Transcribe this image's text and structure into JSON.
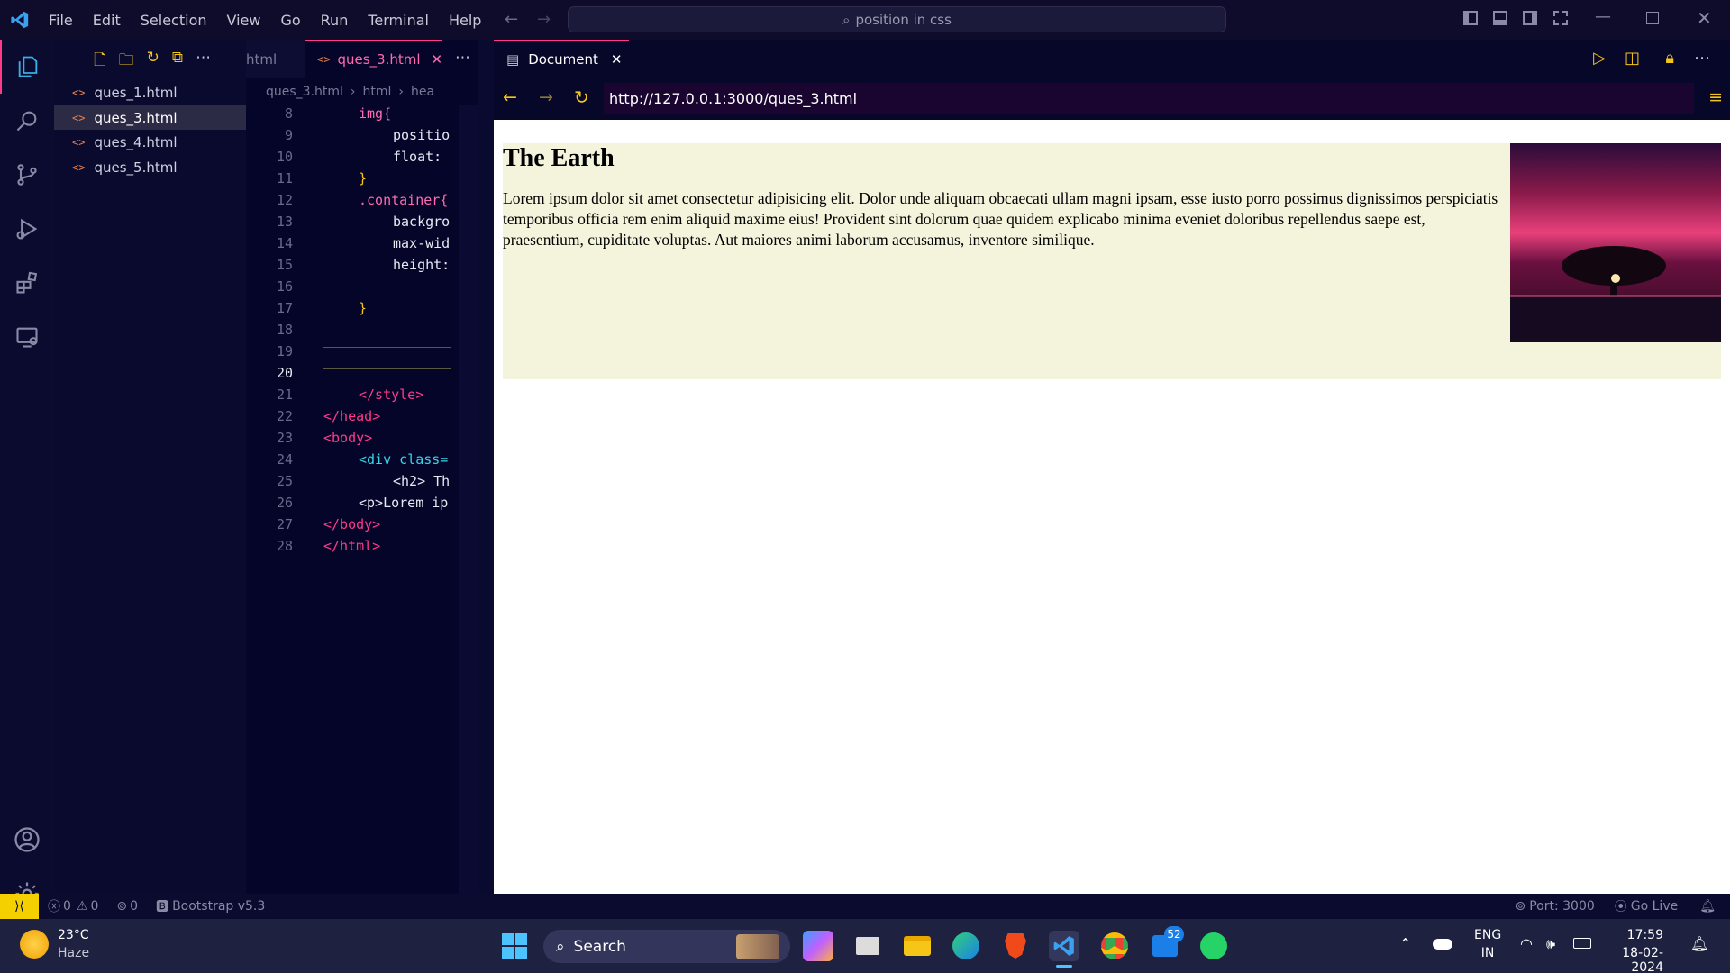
{
  "window": {
    "menu": [
      "File",
      "Edit",
      "Selection",
      "View",
      "Go",
      "Run",
      "Terminal",
      "Help"
    ],
    "command_center": "position in css"
  },
  "explorer": {
    "files": [
      "ques_1.html",
      "ques_3.html",
      "ques_4.html",
      "ques_5.html"
    ],
    "active_file": "ques_3.html"
  },
  "editor": {
    "tab_prev": "html",
    "tab_active": "ques_3.html",
    "breadcrumb": [
      "ques_3.html",
      "html",
      "hea"
    ],
    "active_line": "20",
    "lines": [
      {
        "n": "8",
        "text": "img{"
      },
      {
        "n": "9",
        "text": "positio"
      },
      {
        "n": "10",
        "text": "float:"
      },
      {
        "n": "11",
        "text": "}"
      },
      {
        "n": "12",
        "text": ".container{"
      },
      {
        "n": "13",
        "text": "backgro"
      },
      {
        "n": "14",
        "text": "max-wid"
      },
      {
        "n": "15",
        "text": "height:"
      },
      {
        "n": "16",
        "text": ""
      },
      {
        "n": "17",
        "text": "}"
      },
      {
        "n": "18",
        "text": ""
      },
      {
        "n": "19",
        "text": ""
      },
      {
        "n": "20",
        "text": ""
      },
      {
        "n": "21",
        "text": "</style>"
      },
      {
        "n": "22",
        "text": "</head>"
      },
      {
        "n": "23",
        "text": "<body>"
      },
      {
        "n": "24",
        "text": "<div class="
      },
      {
        "n": "25",
        "text": "<h2> Th"
      },
      {
        "n": "26",
        "text": "<p>Lorem ip"
      },
      {
        "n": "27",
        "text": "</body>"
      },
      {
        "n": "28",
        "text": "</html>"
      }
    ]
  },
  "preview": {
    "tab_label": "Document",
    "url": "http://127.0.0.1:3000/ques_3.html",
    "page_heading": "The Earth",
    "page_paragraph": "Lorem ipsum dolor sit amet consectetur adipisicing elit. Dolor unde aliquam obcaecati ullam magni ipsam, esse iusto porro possimus dignissimos perspiciatis temporibus officia rem enim aliquid maxime eius! Provident sint dolorum quae quidem explicabo minima eveniet doloribus repellendus saepe est, praesentium, cupiditate voluptas. Aut maiores animi laborum accusamus, inventore similique.",
    "container_bg": "#f4f4dc"
  },
  "statusbar": {
    "errors": "0",
    "warnings": "0",
    "ports": "0",
    "bootstrap": "Bootstrap v5.3",
    "port": "Port: 3000",
    "golive": "Go Live"
  },
  "taskbar": {
    "temp": "23°C",
    "weather": "Haze",
    "search": "Search",
    "lang1": "ENG",
    "lang2": "IN",
    "time": "17:59",
    "date": "18-02-2024",
    "badge": "52"
  },
  "colors": {
    "accent": "#ff3a8a",
    "statusbar_remote": "#f5d000"
  }
}
